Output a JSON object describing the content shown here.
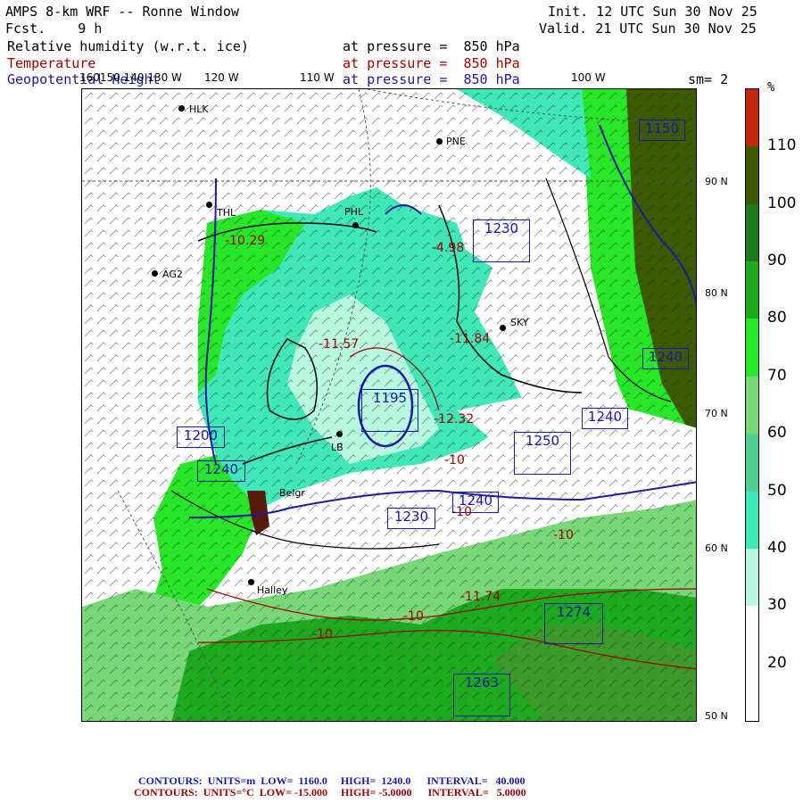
{
  "header": {
    "line1_left": "AMPS 8-km WRF -- Ronne Window",
    "line2_left": "Fcst.    9 h",
    "line1_right": "Init. 12 UTC Sun 30 Nov 25",
    "line2_right": "Valid. 21 UTC Sun 30 Nov 25"
  },
  "fields": [
    {
      "name": "Relative humidity (w.r.t. ice)",
      "level": "at pressure =  850 hPa",
      "color": "#000000"
    },
    {
      "name": "Temperature",
      "level": "at pressure =  850 hPa",
      "color": "#a00000"
    },
    {
      "name": "Geopotential Height",
      "level": "at pressure =  850 hPa",
      "color": "#1a1aa0"
    }
  ],
  "smoothing": "sm= 2",
  "colorbar": {
    "unit": "%",
    "labels": [
      "110",
      "100",
      "90",
      "80",
      "70",
      "60",
      "50",
      "40",
      "30",
      "20"
    ],
    "colors": [
      "#c0280a",
      "#3c5a00",
      "#1e7a1e",
      "#1eaa1e",
      "#28e628",
      "#78d878",
      "#50d090",
      "#40e8b8",
      "#b8f8e0",
      "#ffffff",
      "#ffffff"
    ]
  },
  "lat_labels": [
    "90 N",
    "80 N",
    "70 N",
    "60 N",
    "50 N"
  ],
  "lon_labels": [
    "160150 140 130 W",
    "120 W",
    "110 W",
    "100 W"
  ],
  "stations": [
    "HLK",
    "PNE",
    "THL",
    "PHL",
    "AG2",
    "SKY",
    "LB",
    "Belgr",
    "Halley"
  ],
  "height_boxes": [
    {
      "label": "1150"
    },
    {
      "label": "1240"
    },
    {
      "label": "1240"
    },
    {
      "label": "1230"
    },
    {
      "label": "1240"
    },
    {
      "label": "1250"
    },
    {
      "label": "1200"
    },
    {
      "label": "1240"
    },
    {
      "label": "1195"
    },
    {
      "label": "1274"
    },
    {
      "label": "1263"
    },
    {
      "label": "1230"
    }
  ],
  "temp_labels": [
    "-10.29",
    "-11.57",
    "-11.84",
    "-12.32",
    "-10",
    "-10",
    "-10",
    "-10",
    "-11.74",
    "-10",
    "-4.98"
  ],
  "footer": {
    "line1": "CONTOURS:  UNITS=m  LOW=  1160.0     HIGH=  1240.0      INTERVAL=   40.000",
    "line2": "CONTOURS:  UNITS=°C  LOW= -15.000     HIGH= -5.0000      INTERVAL=   5.0000"
  }
}
